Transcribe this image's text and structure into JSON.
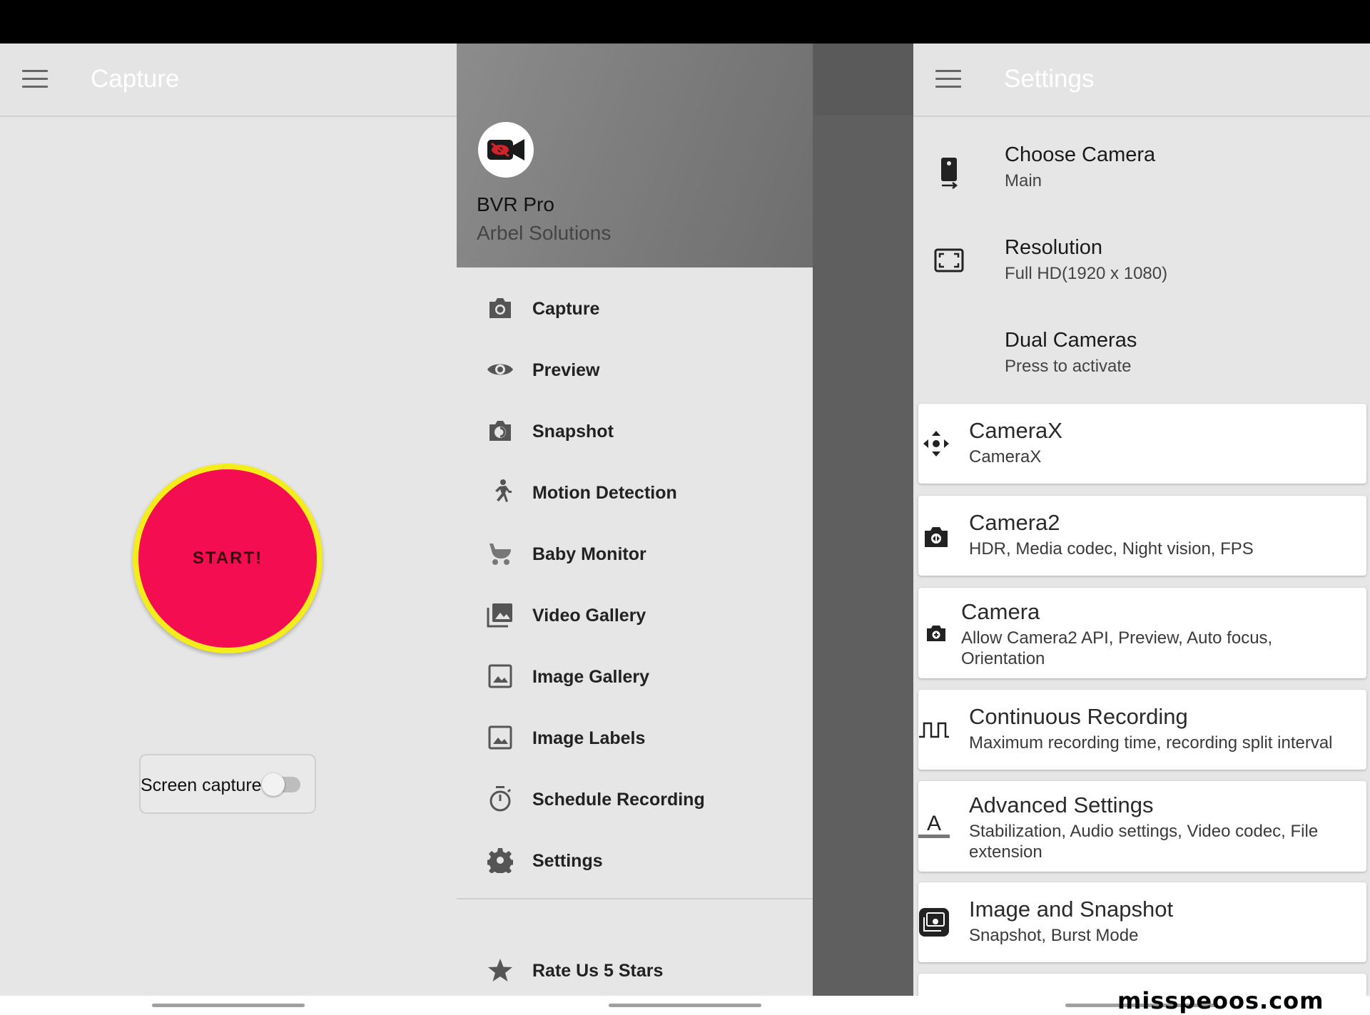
{
  "capture_screen": {
    "title": "Capture",
    "start_button": "START!",
    "screen_capture_label": "Screen capture"
  },
  "drawer": {
    "app_name": "BVR Pro",
    "company": "Arbel Solutions",
    "items": [
      {
        "label": "Capture",
        "icon": "camera-icon"
      },
      {
        "label": "Preview",
        "icon": "eye-icon"
      },
      {
        "label": "Snapshot",
        "icon": "snapshot-icon"
      },
      {
        "label": "Motion Detection",
        "icon": "running-person-icon"
      },
      {
        "label": "Baby Monitor",
        "icon": "stroller-icon"
      },
      {
        "label": "Video Gallery",
        "icon": "video-gallery-icon"
      },
      {
        "label": "Image Gallery",
        "icon": "image-icon"
      },
      {
        "label": "Image Labels",
        "icon": "image-icon"
      },
      {
        "label": "Schedule Recording",
        "icon": "timer-icon"
      },
      {
        "label": "Settings",
        "icon": "gear-icon"
      }
    ],
    "rate_label": "Rate Us 5 Stars"
  },
  "settings": {
    "title": "Settings",
    "rows": [
      {
        "title": "Choose Camera",
        "subtitle": "Main"
      },
      {
        "title": "Resolution",
        "subtitle": "Full HD(1920 x 1080)"
      },
      {
        "title": "Dual Cameras",
        "subtitle": "Press to activate"
      }
    ],
    "cards": [
      {
        "title": "CameraX",
        "subtitle": "CameraX"
      },
      {
        "title": "Camera2",
        "subtitle": "HDR, Media codec, Night vision, FPS"
      },
      {
        "title": "Camera",
        "subtitle": "Allow Camera2 API, Preview, Auto focus, Orientation"
      },
      {
        "title": "Continuous Recording",
        "subtitle": "Maximum recording time, recording split interval"
      },
      {
        "title": "Advanced Settings",
        "subtitle": "Stabilization, Audio settings, Video codec, File extension"
      },
      {
        "title": "Image and Snapshot",
        "subtitle": "Snapshot, Burst Mode"
      }
    ]
  },
  "watermark": "misspeoos.com",
  "colors": {
    "start_fill": "#f50d52",
    "start_ring": "#f5ec1c",
    "background": "#e6e6e6"
  }
}
